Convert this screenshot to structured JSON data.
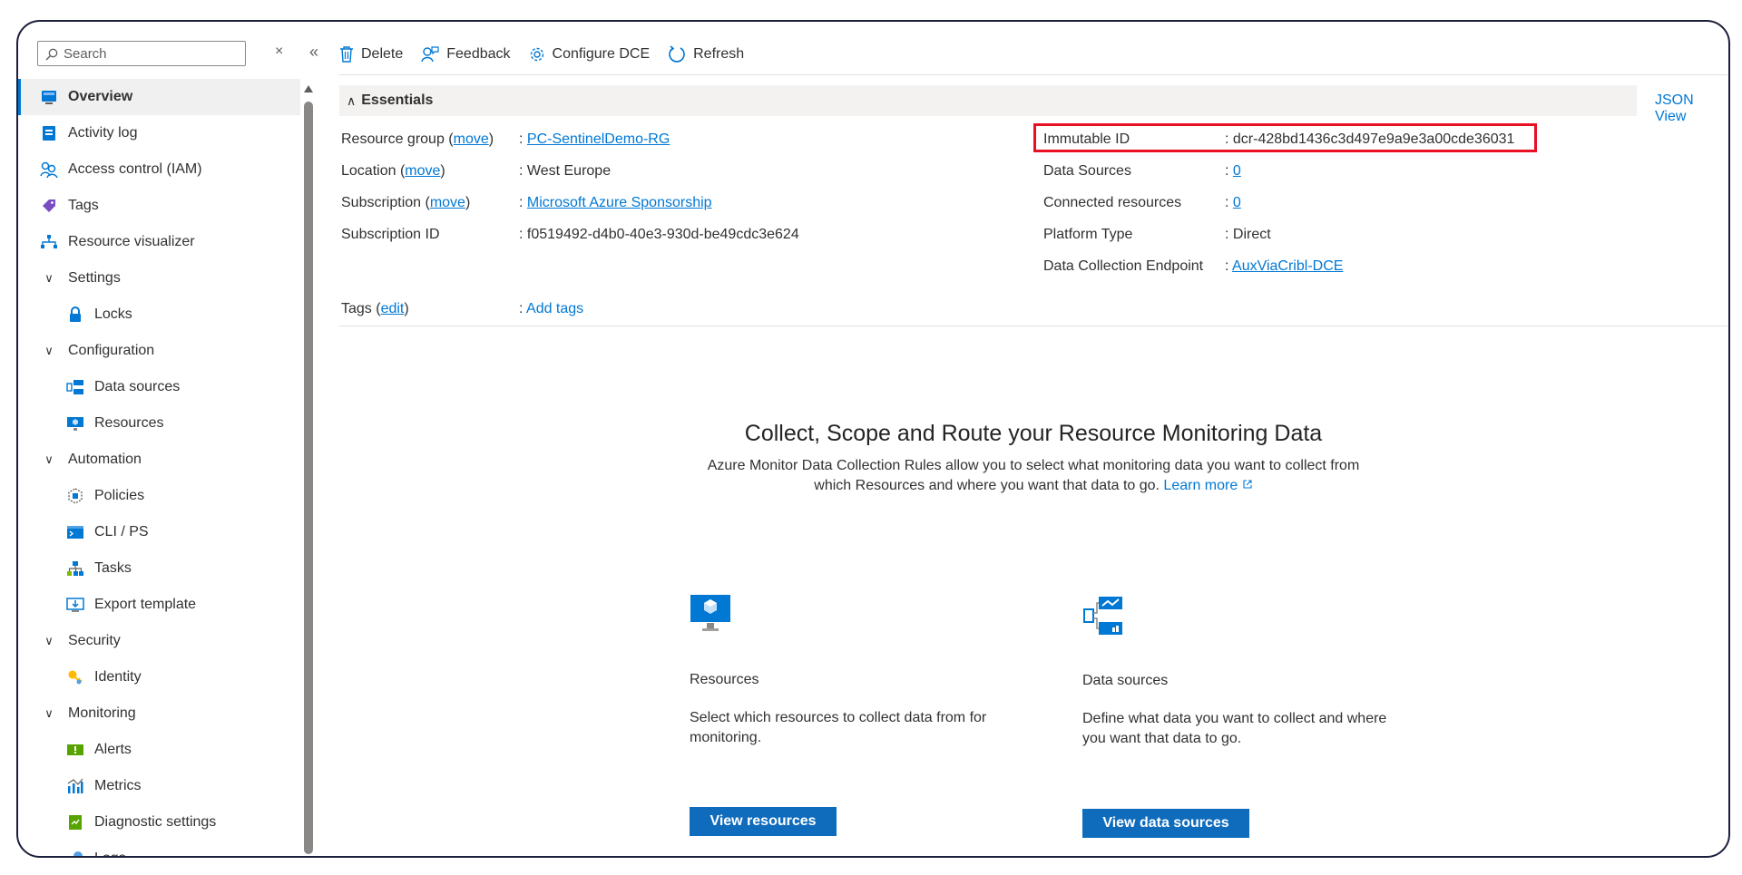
{
  "sidebar": {
    "search_placeholder": "Search",
    "clear_label": "×",
    "collapse_label": "«",
    "items": [
      {
        "label": "Overview"
      },
      {
        "label": "Activity log"
      },
      {
        "label": "Access control (IAM)"
      },
      {
        "label": "Tags"
      },
      {
        "label": "Resource visualizer"
      },
      {
        "label": "Settings"
      },
      {
        "label": "Locks"
      },
      {
        "label": "Configuration"
      },
      {
        "label": "Data sources"
      },
      {
        "label": "Resources"
      },
      {
        "label": "Automation"
      },
      {
        "label": "Policies"
      },
      {
        "label": "CLI / PS"
      },
      {
        "label": "Tasks"
      },
      {
        "label": "Export template"
      },
      {
        "label": "Security"
      },
      {
        "label": "Identity"
      },
      {
        "label": "Monitoring"
      },
      {
        "label": "Alerts"
      },
      {
        "label": "Metrics"
      },
      {
        "label": "Diagnostic settings"
      },
      {
        "label": "Logs"
      }
    ]
  },
  "toolbar": {
    "delete": "Delete",
    "feedback": "Feedback",
    "configure_dce": "Configure DCE",
    "refresh": "Refresh"
  },
  "essentials": {
    "header": "Essentials",
    "json_view": "JSON View",
    "move_label": "move",
    "edit_label": "edit",
    "sep": ":",
    "left": {
      "resource_group_label": "Resource group",
      "resource_group_value": "PC-SentinelDemo-RG",
      "location_label": "Location",
      "location_value": "West Europe",
      "subscription_label": "Subscription",
      "subscription_value": "Microsoft Azure Sponsorship",
      "subscription_id_label": "Subscription ID",
      "subscription_id_value": "f0519492-d4b0-40e3-930d-be49cdc3e624"
    },
    "right": {
      "immutable_id_label": "Immutable ID",
      "immutable_id_value": "dcr-428bd1436c3d497e9a9e3a00cde36031",
      "data_sources_label": "Data Sources",
      "data_sources_value": "0",
      "connected_resources_label": "Connected resources",
      "connected_resources_value": "0",
      "platform_type_label": "Platform Type",
      "platform_type_value": "Direct",
      "dce_label": "Data Collection Endpoint",
      "dce_value": "AuxViaCribl-DCE"
    },
    "tags_label": "Tags",
    "tags_value": "Add tags"
  },
  "hero": {
    "title": "Collect, Scope and Route your Resource Monitoring Data",
    "description_line1": "Azure Monitor Data Collection Rules allow you to select what monitoring data you want to collect from",
    "description_line2": "which Resources and where you want that data to go.",
    "learn_more": "Learn more"
  },
  "cards": {
    "resources": {
      "title": "Resources",
      "description": "Select which resources to collect data from for monitoring.",
      "button": "View resources"
    },
    "data_sources": {
      "title": "Data sources",
      "description": "Define what data you want to collect and where you want that data to go.",
      "button": "View data sources"
    }
  },
  "colors": {
    "accent": "#0078d4",
    "primary_button": "#0f6cbd",
    "highlight_border": "#e81123",
    "essentials_bg": "#f3f2f1"
  }
}
